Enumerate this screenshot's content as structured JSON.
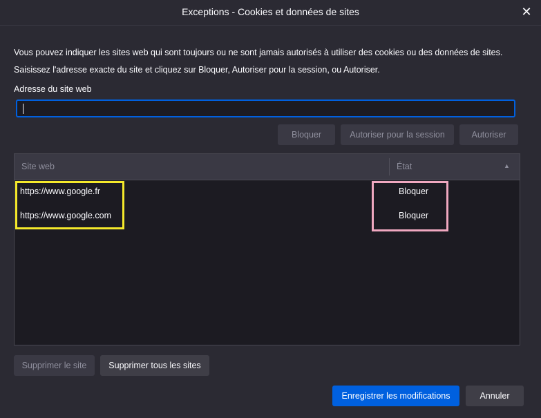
{
  "window": {
    "title": "Exceptions - Cookies et données de sites",
    "close_icon": "close-icon"
  },
  "description": "Vous pouvez indiquer les sites web qui sont toujours ou ne sont jamais autorisés à utiliser des cookies ou des données de sites. Saisissez l'adresse exacte du site et cliquez sur Bloquer, Autoriser pour la session, ou Autoriser.",
  "address": {
    "label": "Adresse du site web",
    "value": ""
  },
  "actions": {
    "block_label": "Bloquer",
    "allow_session_label": "Autoriser pour la session",
    "allow_label": "Autoriser"
  },
  "table": {
    "columns": [
      "Site web",
      "État"
    ],
    "sort_icon": "sort-ascending-icon",
    "rows": [
      {
        "site": "https://www.google.fr",
        "state": "Bloquer"
      },
      {
        "site": "https://www.google.com",
        "state": "Bloquer"
      }
    ]
  },
  "list_actions": {
    "remove_site_label": "Supprimer le site",
    "remove_all_label": "Supprimer tous les sites"
  },
  "footer": {
    "save_label": "Enregistrer les modifications",
    "cancel_label": "Annuler"
  },
  "colors": {
    "background": "#2b2a33",
    "accent": "#0060df",
    "highlight_sites": "#f5e92b",
    "highlight_states": "#f0a8c0"
  }
}
